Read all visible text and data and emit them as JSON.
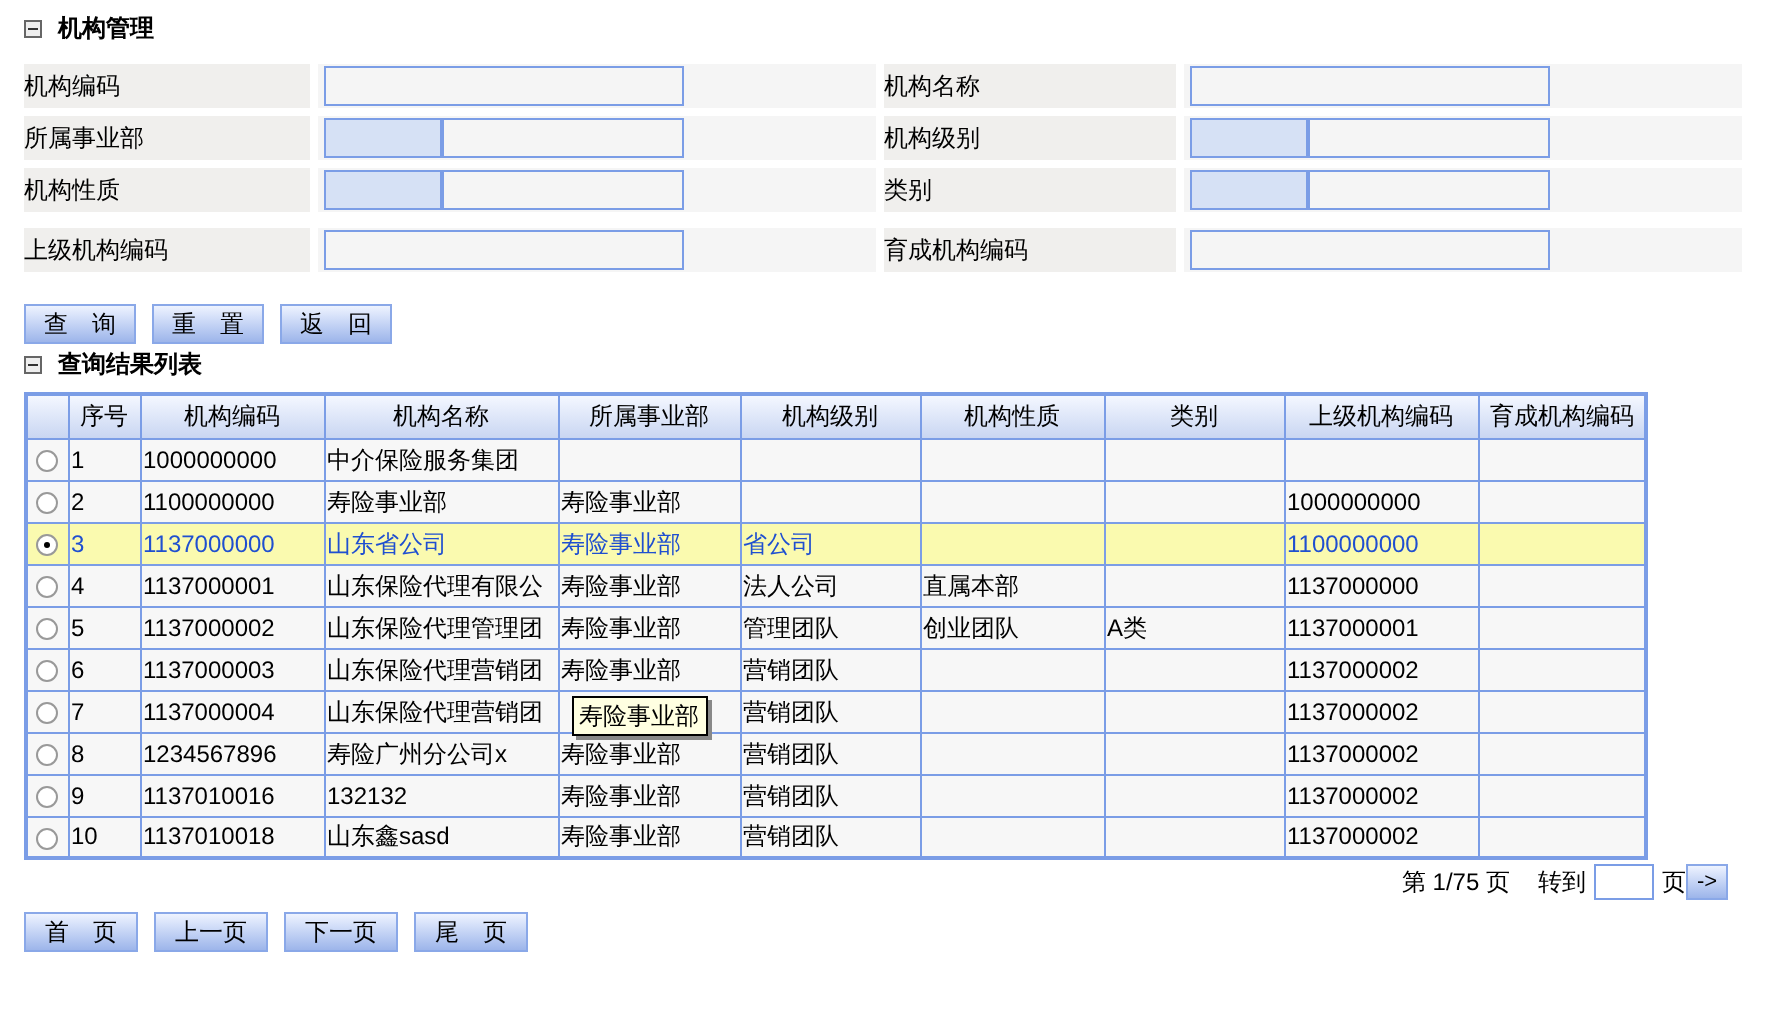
{
  "title": "机构管理",
  "form_fields": [
    {
      "label": "机构编码",
      "kind": "text"
    },
    {
      "label": "机构名称",
      "kind": "text"
    },
    {
      "label": "所属事业部",
      "kind": "select"
    },
    {
      "label": "机构级别",
      "kind": "select"
    },
    {
      "label": "机构性质",
      "kind": "select"
    },
    {
      "label": "类别",
      "kind": "select"
    },
    {
      "label": "上级机构编码",
      "kind": "text"
    },
    {
      "label": "育成机构编码",
      "kind": "text"
    }
  ],
  "buttons": [
    "查　询",
    "重　置",
    "返　回"
  ],
  "results_title": "查询结果列表",
  "table": {
    "columns": [
      "序号",
      "机构编码",
      "机构名称",
      "所属事业部",
      "机构级别",
      "机构性质",
      "类别",
      "上级机构编码",
      "育成机构编码"
    ],
    "rows": [
      {
        "selected": false,
        "cells": [
          "1",
          "1000000000",
          "中介保险服务集团",
          "",
          "",
          "",
          "",
          "",
          ""
        ]
      },
      {
        "selected": false,
        "cells": [
          "2",
          "1100000000",
          "寿险事业部",
          "寿险事业部",
          "",
          "",
          "",
          "1000000000",
          ""
        ]
      },
      {
        "selected": true,
        "cells": [
          "3",
          "1137000000",
          "山东省公司",
          "寿险事业部",
          "省公司",
          "",
          "",
          "1100000000",
          ""
        ]
      },
      {
        "selected": false,
        "cells": [
          "4",
          "1137000001",
          "山东保险代理有限公",
          "寿险事业部",
          "法人公司",
          "直属本部",
          "",
          "1137000000",
          ""
        ]
      },
      {
        "selected": false,
        "cells": [
          "5",
          "1137000002",
          "山东保险代理管理团",
          "寿险事业部",
          "管理团队",
          "创业团队",
          "A类",
          "1137000001",
          ""
        ]
      },
      {
        "selected": false,
        "cells": [
          "6",
          "1137000003",
          "山东保险代理营销团",
          "寿险事业部",
          "营销团队",
          "",
          "",
          "1137000002",
          ""
        ]
      },
      {
        "selected": false,
        "cells": [
          "7",
          "1137000004",
          "山东保险代理营销团",
          "",
          "营销团队",
          "",
          "",
          "1137000002",
          ""
        ]
      },
      {
        "selected": false,
        "cells": [
          "8",
          "1234567896",
          "寿险广州分公司x",
          "寿险事业部",
          "营销团队",
          "",
          "",
          "1137000002",
          ""
        ]
      },
      {
        "selected": false,
        "cells": [
          "9",
          "1137010016",
          "132132",
          "寿险事业部",
          "营销团队",
          "",
          "",
          "1137000002",
          ""
        ]
      },
      {
        "selected": false,
        "cells": [
          "10",
          "1137010018",
          "山东鑫sasd",
          "寿险事业部",
          "营销团队",
          "",
          "",
          "1137000002",
          ""
        ]
      }
    ]
  },
  "tooltip": "寿险事业部",
  "pagination": {
    "page_label": "第 1/75 页",
    "goto_label": "转到",
    "page_suffix": "页",
    "go_button": "->"
  },
  "nav_buttons": [
    "首　页",
    "上一页",
    "下一页",
    "尾　页"
  ]
}
